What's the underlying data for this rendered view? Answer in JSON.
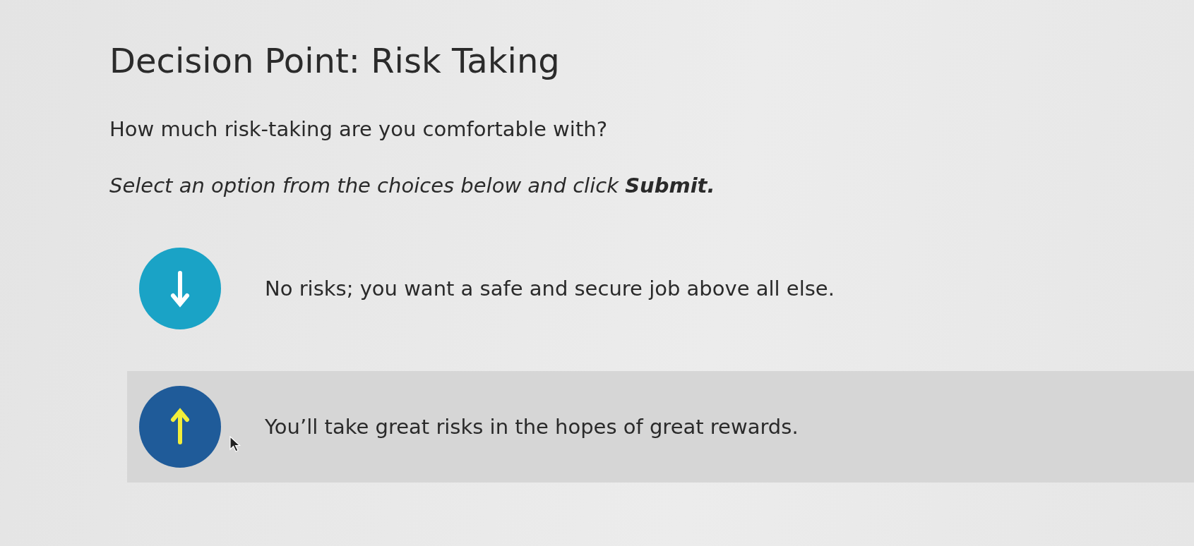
{
  "title": "Decision Point: Risk Taking",
  "question": "How much risk-taking are you comfortable with?",
  "instruction": "Select an option from the choices below and click **Submit.**",
  "options": [
    {
      "kind": "down",
      "label": "No risks; you want a safe and secure job above all else.",
      "selected": false
    },
    {
      "kind": "up",
      "label": "You’ll take great risks in the hopes of great rewards.",
      "selected": true
    }
  ]
}
